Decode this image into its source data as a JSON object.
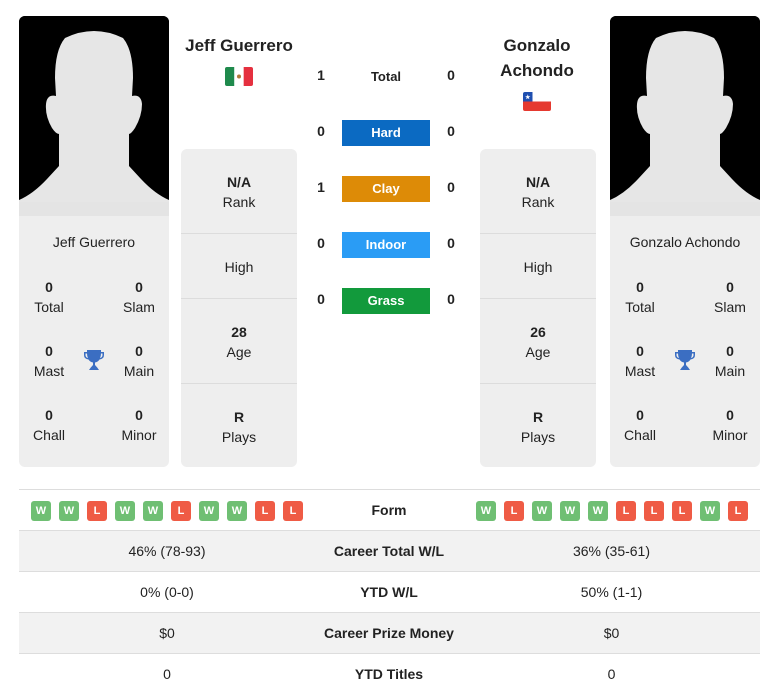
{
  "colors": {
    "hard": "#0b6ac2",
    "clay": "#dd8b07",
    "indoor": "#2a9cf5",
    "grass": "#129a3c",
    "win": "#6fbf73",
    "loss": "#ef5b45",
    "trophy": "#3b6ec2"
  },
  "player1": {
    "name": "Jeff Guerrero",
    "flag": "mexico-flag",
    "titles": {
      "total": {
        "value": "0",
        "label": "Total"
      },
      "slam": {
        "value": "0",
        "label": "Slam"
      },
      "mast": {
        "value": "0",
        "label": "Mast"
      },
      "main": {
        "value": "0",
        "label": "Main"
      },
      "chall": {
        "value": "0",
        "label": "Chall"
      },
      "minor": {
        "value": "0",
        "label": "Minor"
      }
    },
    "stats": {
      "rank": {
        "value": "N/A",
        "label": "Rank"
      },
      "high": {
        "label": "High"
      },
      "age": {
        "value": "28",
        "label": "Age"
      },
      "plays": {
        "value": "R",
        "label": "Plays"
      }
    }
  },
  "player2": {
    "name": "Gonzalo Achondo",
    "name_line1": "Gonzalo",
    "name_line2": "Achondo",
    "flag": "chile-flag",
    "titles": {
      "total": {
        "value": "0",
        "label": "Total"
      },
      "slam": {
        "value": "0",
        "label": "Slam"
      },
      "mast": {
        "value": "0",
        "label": "Mast"
      },
      "main": {
        "value": "0",
        "label": "Main"
      },
      "chall": {
        "value": "0",
        "label": "Chall"
      },
      "minor": {
        "value": "0",
        "label": "Minor"
      }
    },
    "stats": {
      "rank": {
        "value": "N/A",
        "label": "Rank"
      },
      "high": {
        "label": "High"
      },
      "age": {
        "value": "26",
        "label": "Age"
      },
      "plays": {
        "value": "R",
        "label": "Plays"
      }
    }
  },
  "h2h": {
    "total": {
      "label": "Total",
      "p1": "1",
      "p2": "0"
    },
    "surfaces": [
      {
        "label": "Hard",
        "p1": "0",
        "p2": "0",
        "color": "#0b6ac2"
      },
      {
        "label": "Clay",
        "p1": "1",
        "p2": "0",
        "color": "#dd8b07"
      },
      {
        "label": "Indoor",
        "p1": "0",
        "p2": "0",
        "color": "#2a9cf5"
      },
      {
        "label": "Grass",
        "p1": "0",
        "p2": "0",
        "color": "#129a3c"
      }
    ]
  },
  "comparison": {
    "form": {
      "label": "Form",
      "p1": [
        "W",
        "W",
        "L",
        "W",
        "W",
        "L",
        "W",
        "W",
        "L",
        "L"
      ],
      "p2": [
        "W",
        "L",
        "W",
        "W",
        "W",
        "L",
        "L",
        "L",
        "W",
        "L"
      ]
    },
    "rows": [
      {
        "label": "Career Total W/L",
        "p1": "46% (78-93)",
        "p2": "36% (35-61)"
      },
      {
        "label": "YTD W/L",
        "p1": "0% (0-0)",
        "p2": "50% (1-1)"
      },
      {
        "label": "Career Prize Money",
        "p1": "$0",
        "p2": "$0"
      },
      {
        "label": "YTD Titles",
        "p1": "0",
        "p2": "0"
      }
    ]
  }
}
